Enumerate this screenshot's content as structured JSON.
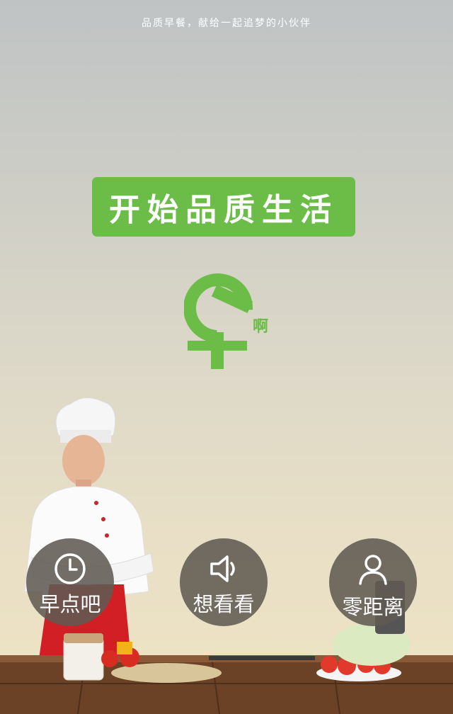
{
  "header": {
    "tagline": "品质早餐，献给一起追梦的小伙伴"
  },
  "hero": {
    "banner_text": "开始品质生活"
  },
  "logo": {
    "text": "啊"
  },
  "nav": {
    "buttons": [
      {
        "label": "早点吧",
        "icon": "clock-icon"
      },
      {
        "label": "想看看",
        "icon": "speaker-icon"
      },
      {
        "label": "零距离",
        "icon": "user-icon"
      }
    ]
  },
  "colors": {
    "brand_green": "#6cbd48",
    "button_bg": "#605a52",
    "text_white": "#ffffff"
  }
}
